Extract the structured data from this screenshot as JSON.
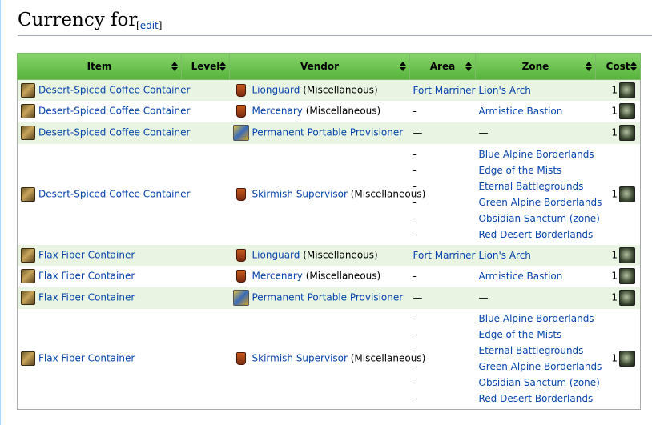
{
  "heading": {
    "title": "Currency for",
    "edit_label": "edit"
  },
  "table": {
    "headers": {
      "item": "Item",
      "level": "Level",
      "vendor": "Vendor",
      "area": "Area",
      "zone": "Zone",
      "cost": "Cost"
    },
    "rows": [
      {
        "item": "Desert-Spiced Coffee Container",
        "vendor": "Lionguard",
        "vendor_note": "(Miscellaneous)",
        "areas": [
          "Fort Marriner"
        ],
        "zones": [
          "Lion's Arch"
        ],
        "cost": "1"
      },
      {
        "item": "Desert-Spiced Coffee Container",
        "vendor": "Mercenary",
        "vendor_note": "(Miscellaneous)",
        "areas": [
          "-"
        ],
        "zones": [
          "Armistice Bastion"
        ],
        "cost": "1"
      },
      {
        "item": "Desert-Spiced Coffee Container",
        "vendor": "Permanent Portable Provisioner",
        "vendor_note": "",
        "areas": [
          "—"
        ],
        "zones": [
          "—"
        ],
        "cost": "1"
      },
      {
        "item": "Desert-Spiced Coffee Container",
        "vendor": "Skirmish Supervisor",
        "vendor_note": "(Miscellaneous)",
        "areas": [
          "-",
          "-",
          "-",
          "-",
          "-",
          "-"
        ],
        "zones": [
          "Blue Alpine Borderlands",
          "Edge of the Mists",
          "Eternal Battlegrounds",
          "Green Alpine Borderlands",
          "Obsidian Sanctum (zone)",
          "Red Desert Borderlands"
        ],
        "cost": "1"
      },
      {
        "item": "Flax Fiber Container",
        "vendor": "Lionguard",
        "vendor_note": "(Miscellaneous)",
        "areas": [
          "Fort Marriner"
        ],
        "zones": [
          "Lion's Arch"
        ],
        "cost": "1"
      },
      {
        "item": "Flax Fiber Container",
        "vendor": "Mercenary",
        "vendor_note": "(Miscellaneous)",
        "areas": [
          "-"
        ],
        "zones": [
          "Armistice Bastion"
        ],
        "cost": "1"
      },
      {
        "item": "Flax Fiber Container",
        "vendor": "Permanent Portable Provisioner",
        "vendor_note": "",
        "areas": [
          "—"
        ],
        "zones": [
          "—"
        ],
        "cost": "1"
      },
      {
        "item": "Flax Fiber Container",
        "vendor": "Skirmish Supervisor",
        "vendor_note": "(Miscellaneous)",
        "areas": [
          "-",
          "-",
          "-",
          "-",
          "-",
          "-"
        ],
        "zones": [
          "Blue Alpine Borderlands",
          "Edge of the Mists",
          "Eternal Battlegrounds",
          "Green Alpine Borderlands",
          "Obsidian Sanctum (zone)",
          "Red Desert Borderlands"
        ],
        "cost": "1"
      }
    ]
  },
  "icons": {
    "item": "container-icon",
    "vendor": "vendor-icon",
    "provisioner": "provisioner-icon",
    "cost": "currency-coin-icon"
  },
  "colors": {
    "header_green": "#6cc452",
    "row_shade": "#e9f5e2",
    "link": "#0645ad"
  }
}
